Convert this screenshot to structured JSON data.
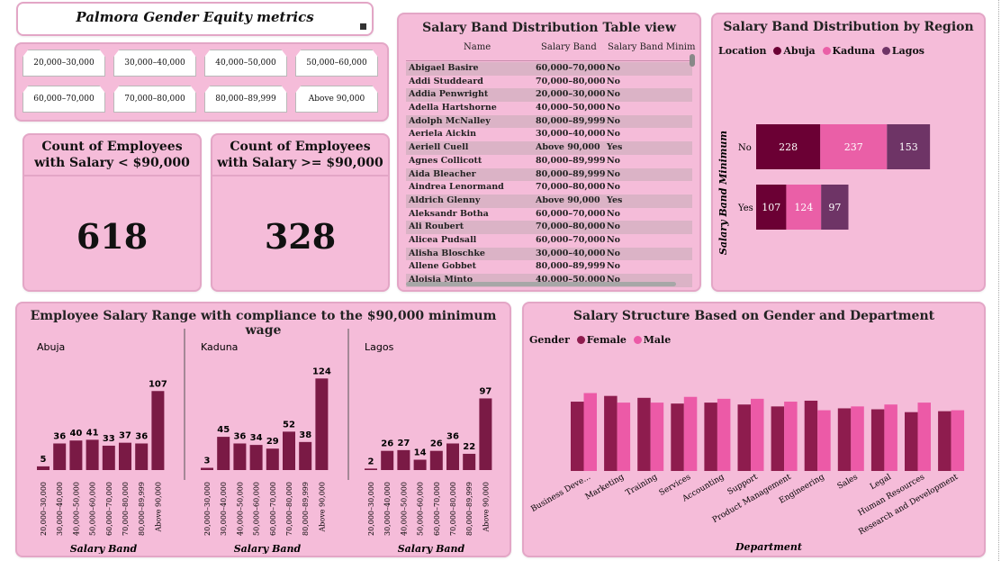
{
  "title": "Palmora Gender Equity metrics",
  "slicer": {
    "bands": [
      "20,000–30,000",
      "30,000–40,000",
      "40,000–50,000",
      "50,000–60,000",
      "60,000–70,000",
      "70,000–80,000",
      "80,000–89,999",
      "Above 90,000"
    ]
  },
  "kpi": {
    "below": {
      "label": "Count of Employees with Salary < $90,000",
      "value": "618"
    },
    "above": {
      "label": "Count of Employees with Salary >= $90,000",
      "value": "328"
    }
  },
  "table": {
    "title": "Salary Band Distribution Table view",
    "columns": [
      "Name",
      "Salary Band",
      "Salary Band Minim"
    ],
    "rows": [
      [
        "Abigael Basire",
        "60,000–70,000",
        "No"
      ],
      [
        "Addi Studdeard",
        "70,000–80,000",
        "No"
      ],
      [
        "Addia Penwright",
        "20,000–30,000",
        "No"
      ],
      [
        "Adella Hartshorne",
        "40,000–50,000",
        "No"
      ],
      [
        "Adolph McNalley",
        "80,000–89,999",
        "No"
      ],
      [
        "Aeriela Aickin",
        "30,000–40,000",
        "No"
      ],
      [
        "Aeriell Cuell",
        "Above 90,000",
        "Yes"
      ],
      [
        "Agnes Collicott",
        "80,000–89,999",
        "No"
      ],
      [
        "Aida Bleacher",
        "80,000–89,999",
        "No"
      ],
      [
        "Aindrea Lenormand",
        "70,000–80,000",
        "No"
      ],
      [
        "Aldrich Glenny",
        "Above 90,000",
        "Yes"
      ],
      [
        "Aleksandr Botha",
        "60,000–70,000",
        "No"
      ],
      [
        "Ali Roubert",
        "70,000–80,000",
        "No"
      ],
      [
        "Alicea Pudsall",
        "60,000–70,000",
        "No"
      ],
      [
        "Alisha Bloschke",
        "30,000–40,000",
        "No"
      ],
      [
        "Allene Gobbet",
        "80,000–89,999",
        "No"
      ],
      [
        "Aloisia Minto",
        "40,000–50,000",
        "No"
      ]
    ]
  },
  "region_chart": {
    "title": "Salary Band Distribution by Region",
    "legend_title": "Location",
    "ylabel": "Salary Band Minimum"
  },
  "range_chart": {
    "title": "Employee Salary Range with compliance to the $90,000 minimum wage",
    "xlabel": "Salary Band"
  },
  "gender_chart": {
    "title": "Salary Structure Based on Gender and Department",
    "legend_title": "Gender",
    "xlabel": "Department"
  },
  "colors": {
    "panel_bg": "#f5bcd9",
    "abuja": "#6b0034",
    "kaduna": "#ea5fa7",
    "lagos": "#6e3466",
    "female": "#8e1c4e",
    "male": "#ec5aa7",
    "range_bar": "#7a1a45"
  },
  "chart_data": [
    {
      "type": "bar",
      "orientation": "horizontal",
      "stacked": true,
      "title": "Salary Band Distribution by Region",
      "ylabel": "Salary Band Minimum",
      "categories": [
        "No",
        "Yes"
      ],
      "series": [
        {
          "name": "Abuja",
          "values": [
            228,
            107
          ]
        },
        {
          "name": "Kaduna",
          "values": [
            237,
            124
          ]
        },
        {
          "name": "Lagos",
          "values": [
            153,
            97
          ]
        }
      ],
      "legend": "top-left"
    },
    {
      "type": "bar",
      "title": "Employee Salary Range with compliance to the $90,000 minimum wage",
      "xlabel": "Salary Band",
      "categories": [
        "20,000–30,000",
        "30,000–40,000",
        "40,000–50,000",
        "50,000–60,000",
        "60,000–70,000",
        "70,000–80,000",
        "80,000–89,999",
        "Above 90,000"
      ],
      "panels": [
        {
          "name": "Abuja",
          "values": [
            5,
            36,
            40,
            41,
            33,
            37,
            36,
            107
          ]
        },
        {
          "name": "Kaduna",
          "values": [
            3,
            45,
            36,
            34,
            29,
            52,
            38,
            124
          ]
        },
        {
          "name": "Lagos",
          "values": [
            2,
            26,
            27,
            14,
            26,
            36,
            22,
            97
          ]
        }
      ]
    },
    {
      "type": "bar",
      "title": "Salary Structure Based on Gender and Department",
      "xlabel": "Department",
      "categories": [
        "Business Deve...",
        "Marketing",
        "Training",
        "Services",
        "Accounting",
        "Support",
        "Product Management",
        "Engineering",
        "Sales",
        "Legal",
        "Human Resources",
        "Research and Development"
      ],
      "series": [
        {
          "name": "Female",
          "values": [
            96,
            102,
            100,
            94,
            95,
            93,
            91,
            97,
            89,
            88,
            85,
            86
          ]
        },
        {
          "name": "Male",
          "values": [
            105,
            95,
            95,
            101,
            99,
            99,
            96,
            87,
            91,
            93,
            95,
            87
          ]
        }
      ],
      "legend": "top-left"
    }
  ]
}
